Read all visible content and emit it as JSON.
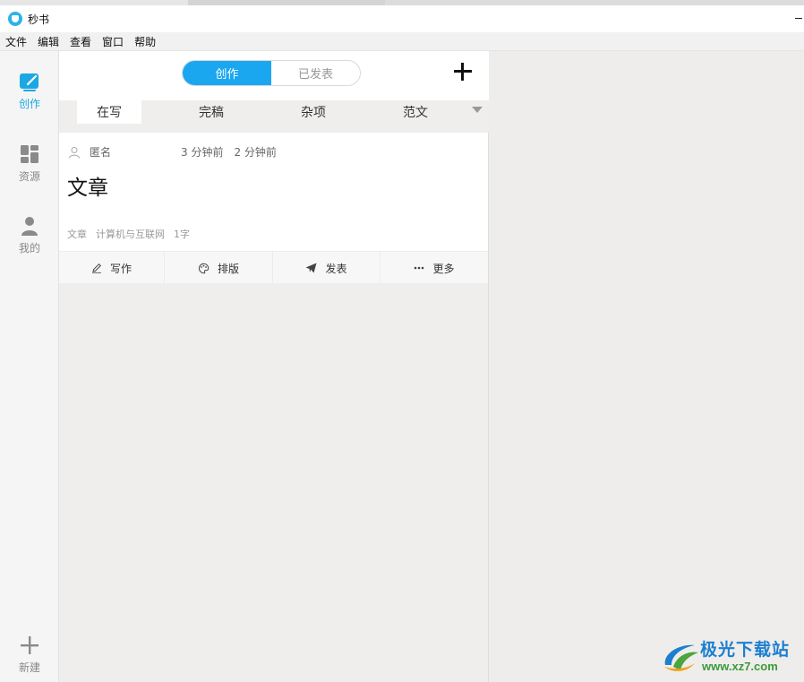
{
  "window": {
    "title": "秒书"
  },
  "menubar": {
    "items": [
      "文件",
      "编辑",
      "查看",
      "窗口",
      "帮助"
    ]
  },
  "leftnav": {
    "create_label": "创作",
    "resources_label": "资源",
    "mine_label": "我的",
    "new_label": "新建"
  },
  "mid": {
    "segment": {
      "active": "创作",
      "inactive": "已发表"
    },
    "tabs": [
      "在写",
      "完稿",
      "杂项",
      "范文"
    ],
    "card": {
      "author": "匿名",
      "time_created": "3 分钟前",
      "time_modified": "2 分钟前",
      "title": "文章",
      "tags": [
        "文章",
        "计算机与互联网",
        "1字"
      ],
      "actions": [
        "写作",
        "排版",
        "发表",
        "更多"
      ]
    }
  },
  "watermark": {
    "cn": "极光下载站",
    "en": "www.xz7.com"
  },
  "colors": {
    "accent": "#1ba7f0",
    "nav_active": "#1ba7e4"
  }
}
